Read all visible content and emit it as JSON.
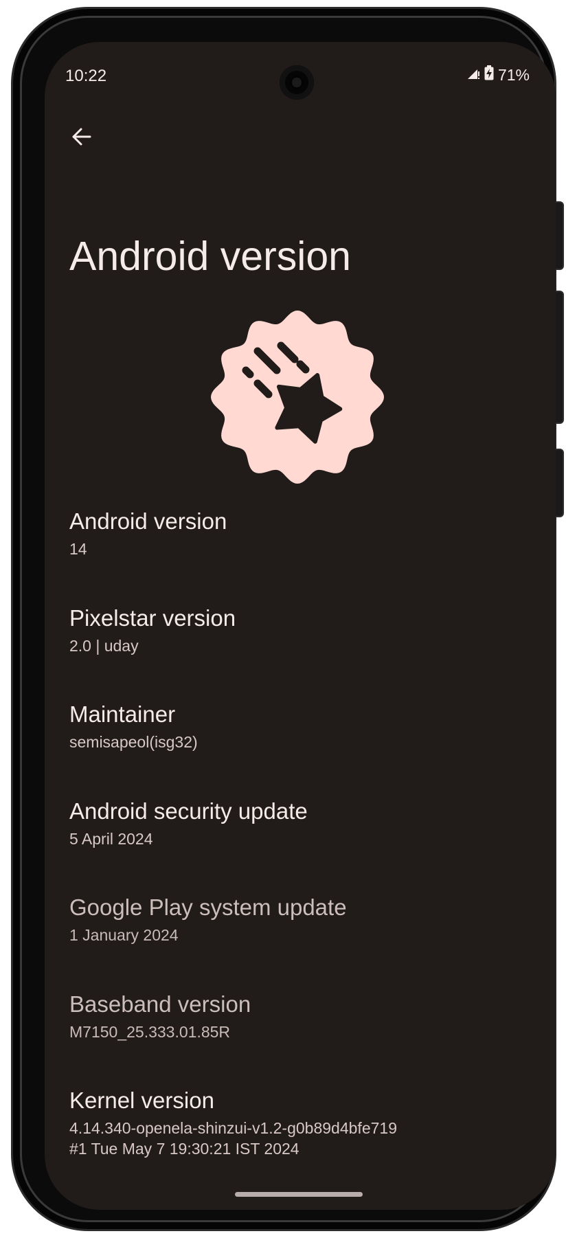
{
  "status_bar": {
    "time": "10:22",
    "battery_percent": "71%",
    "signal_icon": "cell-signal-icon",
    "battery_icon": "battery-charging-icon"
  },
  "toolbar": {
    "back_icon": "arrow-back-icon"
  },
  "page": {
    "title": "Android version",
    "badge_icon": "shooting-star-icon",
    "badge_color": "#ffd9d2",
    "background_color": "#211b1a"
  },
  "items": [
    {
      "title": "Android version",
      "value": "14"
    },
    {
      "title": "Pixelstar version",
      "value": "2.0 | uday"
    },
    {
      "title": "Maintainer",
      "value": "semisapeol(isg32)"
    },
    {
      "title": "Android security update",
      "value": "5 April 2024"
    },
    {
      "title": "Google Play system update",
      "value": "1 January 2024"
    },
    {
      "title": "Baseband version",
      "value": "M7150_25.333.01.85R"
    },
    {
      "title": "Kernel version",
      "value": "4.14.340-openela-shinzui-v1.2-g0b89d4bfe719",
      "value_line2": "#1 Tue May 7 19:30:21 IST 2024"
    }
  ]
}
